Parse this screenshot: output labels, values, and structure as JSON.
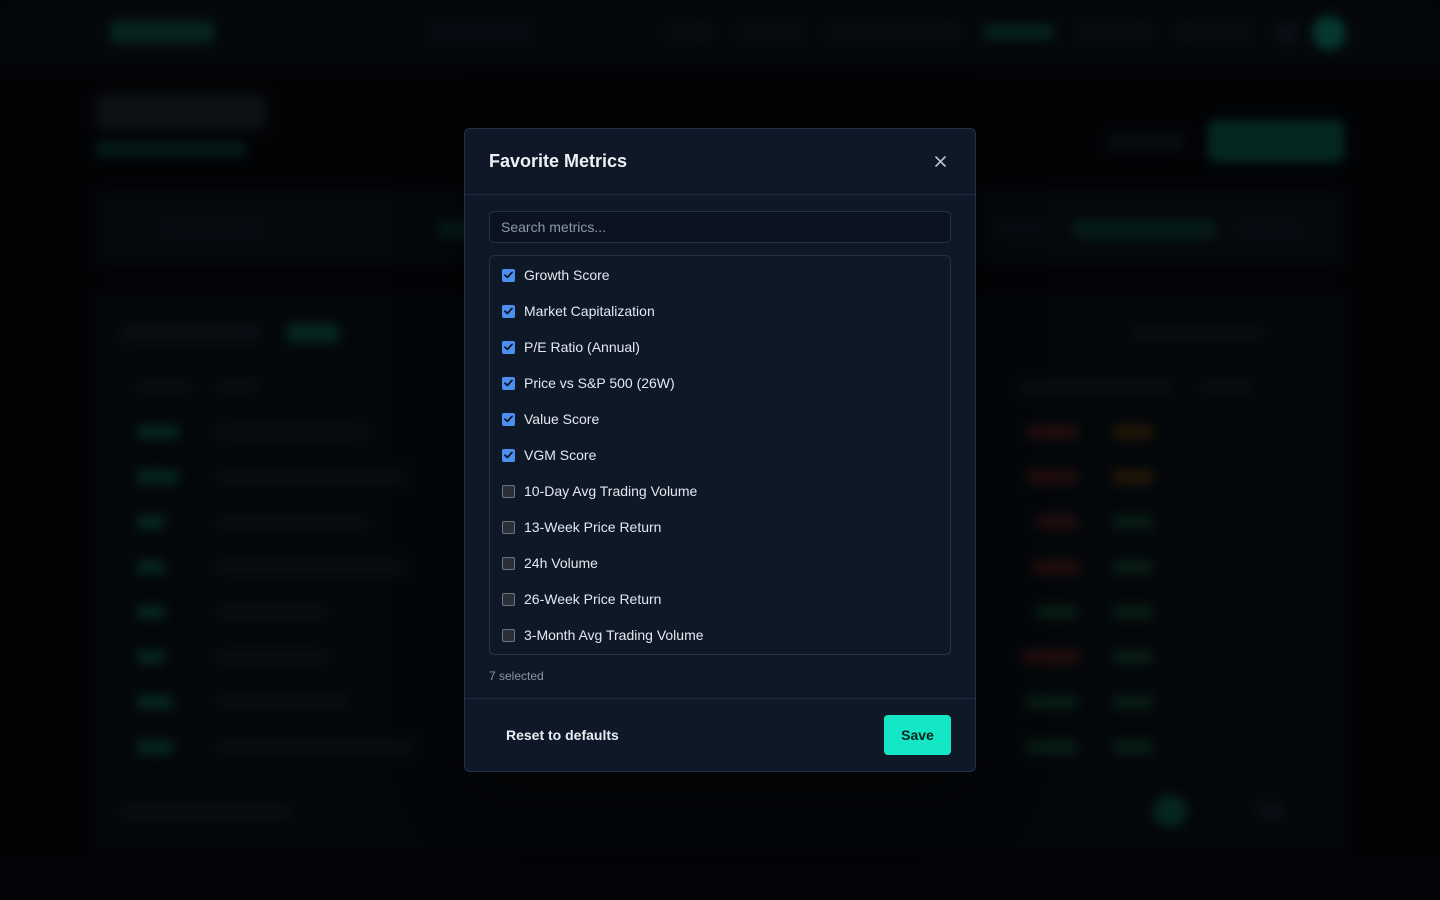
{
  "modal": {
    "title": "Favorite Metrics",
    "close_icon": "close-icon",
    "search": {
      "placeholder": "Search metrics...",
      "value": ""
    },
    "metrics": [
      {
        "label": "Growth Score",
        "checked": true
      },
      {
        "label": "Market Capitalization",
        "checked": true
      },
      {
        "label": "P/E Ratio (Annual)",
        "checked": true
      },
      {
        "label": "Price vs S&P 500 (26W)",
        "checked": true
      },
      {
        "label": "Value Score",
        "checked": true
      },
      {
        "label": "VGM Score",
        "checked": true
      },
      {
        "label": "10-Day Avg Trading Volume",
        "checked": false
      },
      {
        "label": "13-Week Price Return",
        "checked": false
      },
      {
        "label": "24h Volume",
        "checked": false
      },
      {
        "label": "26-Week Price Return",
        "checked": false
      },
      {
        "label": "3-Month Avg Trading Volume",
        "checked": false
      }
    ],
    "selected_count_text": "7 selected",
    "reset_label": "Reset to defaults",
    "save_label": "Save"
  },
  "colors": {
    "accent": "#14e6c6",
    "checkbox_checked": "#4d8ff0",
    "modal_bg": "#0f1826",
    "page_bg": "#05080d"
  }
}
